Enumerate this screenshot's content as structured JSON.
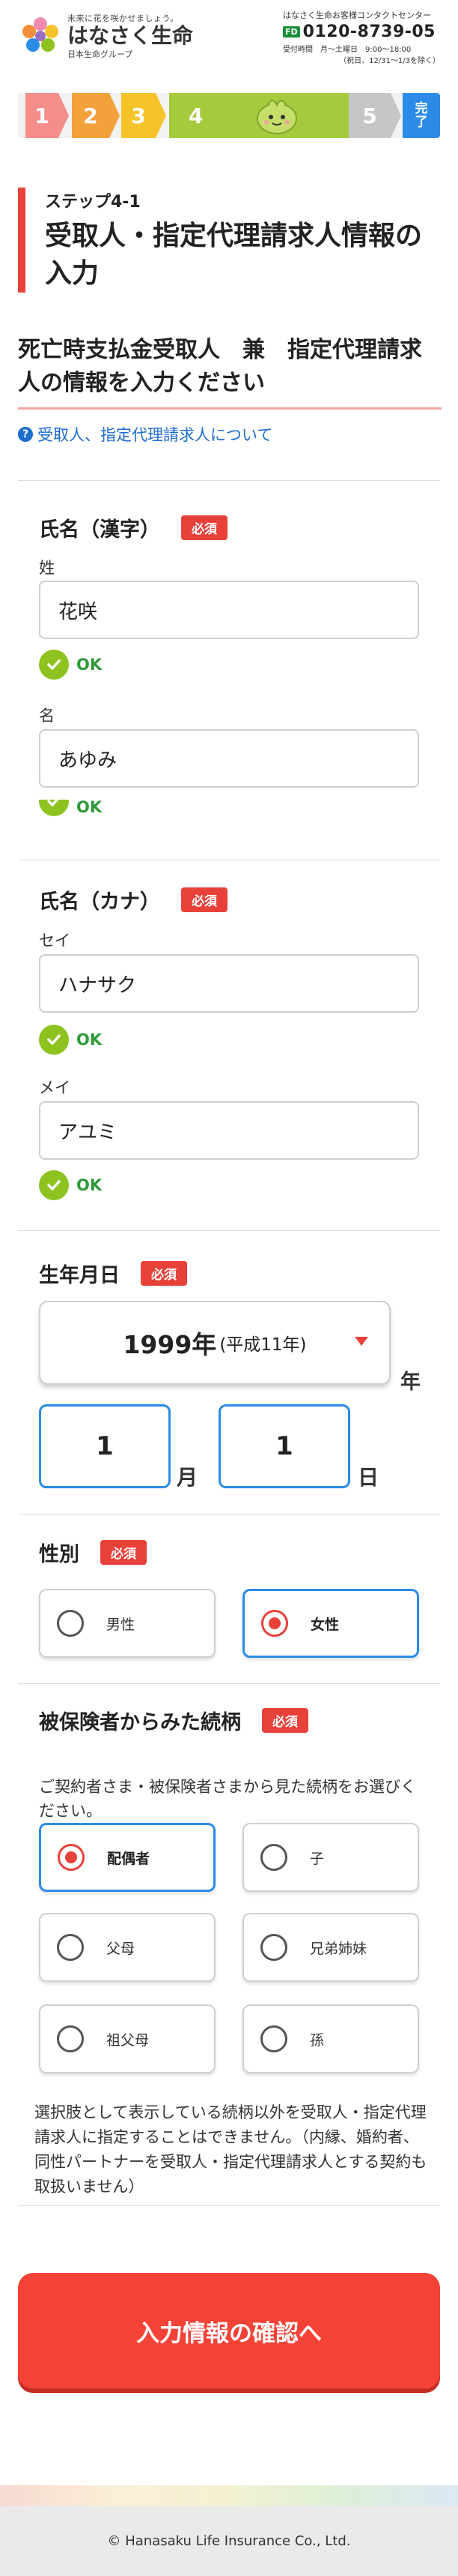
{
  "header": {
    "tagline": "未来に花を咲かせましょう。",
    "logo_name": "はなさく生命",
    "group": "日本生命グループ",
    "contact_title": "はなさく生命お客様コンタクトセンター",
    "freedial": "FD",
    "tel": "0120-8739-05",
    "hours": "受付時間　月〜土曜日　9:00〜18:00",
    "hours_note": "（祝日、12/31〜1/3を除く）"
  },
  "progress": {
    "steps": [
      "1",
      "2",
      "3",
      "4",
      "5",
      "完\n了"
    ],
    "current": 4
  },
  "page": {
    "step_label": "ステップ4-1",
    "title": "受取人・指定代理請求人情報の入力",
    "section_heading": "死亡時支払金受取人　兼　指定代理請求人の情報を入力ください",
    "help_link": "受取人、指定代理請求人について",
    "required": "必須"
  },
  "name_kanji": {
    "label": "氏名（漢字）",
    "last_label": "姓",
    "last_value": "花咲",
    "first_label": "名",
    "first_value": "あゆみ",
    "ok": "OK"
  },
  "name_kana": {
    "label": "氏名（カナ）",
    "last_label": "セイ",
    "last_value": "ハナサク",
    "first_label": "メイ",
    "first_value": "アユミ",
    "ok": "OK"
  },
  "birthdate": {
    "label": "生年月日",
    "year_value": "1999年",
    "year_sub": "(平成11年)",
    "year_unit": "年",
    "month_value": "1",
    "month_unit": "月",
    "day_value": "1",
    "day_unit": "日"
  },
  "gender": {
    "label": "性別",
    "options": [
      "男性",
      "女性"
    ],
    "selected": "女性"
  },
  "relationship": {
    "label": "被保険者からみた続柄",
    "description": "ご契約者さま・被保険者さまから見た続柄をお選びください。",
    "options": [
      "配偶者",
      "子",
      "父母",
      "兄弟姉妹",
      "祖父母",
      "孫"
    ],
    "selected": "配偶者",
    "note": "選択肢として表示している続柄以外を受取人・指定代理請求人に指定することはできません。（内縁、婚約者、同性パートナーを受取人・指定代理請求人とする契約も取扱いません）"
  },
  "submit_label": "入力情報の確認へ",
  "footer": "© Hanasaku Life Insurance Co., Ltd.",
  "colors": {
    "accent_red": "#e8413a",
    "submit": "#f44336",
    "link": "#1c6dd0",
    "selected_border": "#2b8be6",
    "ok_green": "#8dc21f"
  }
}
